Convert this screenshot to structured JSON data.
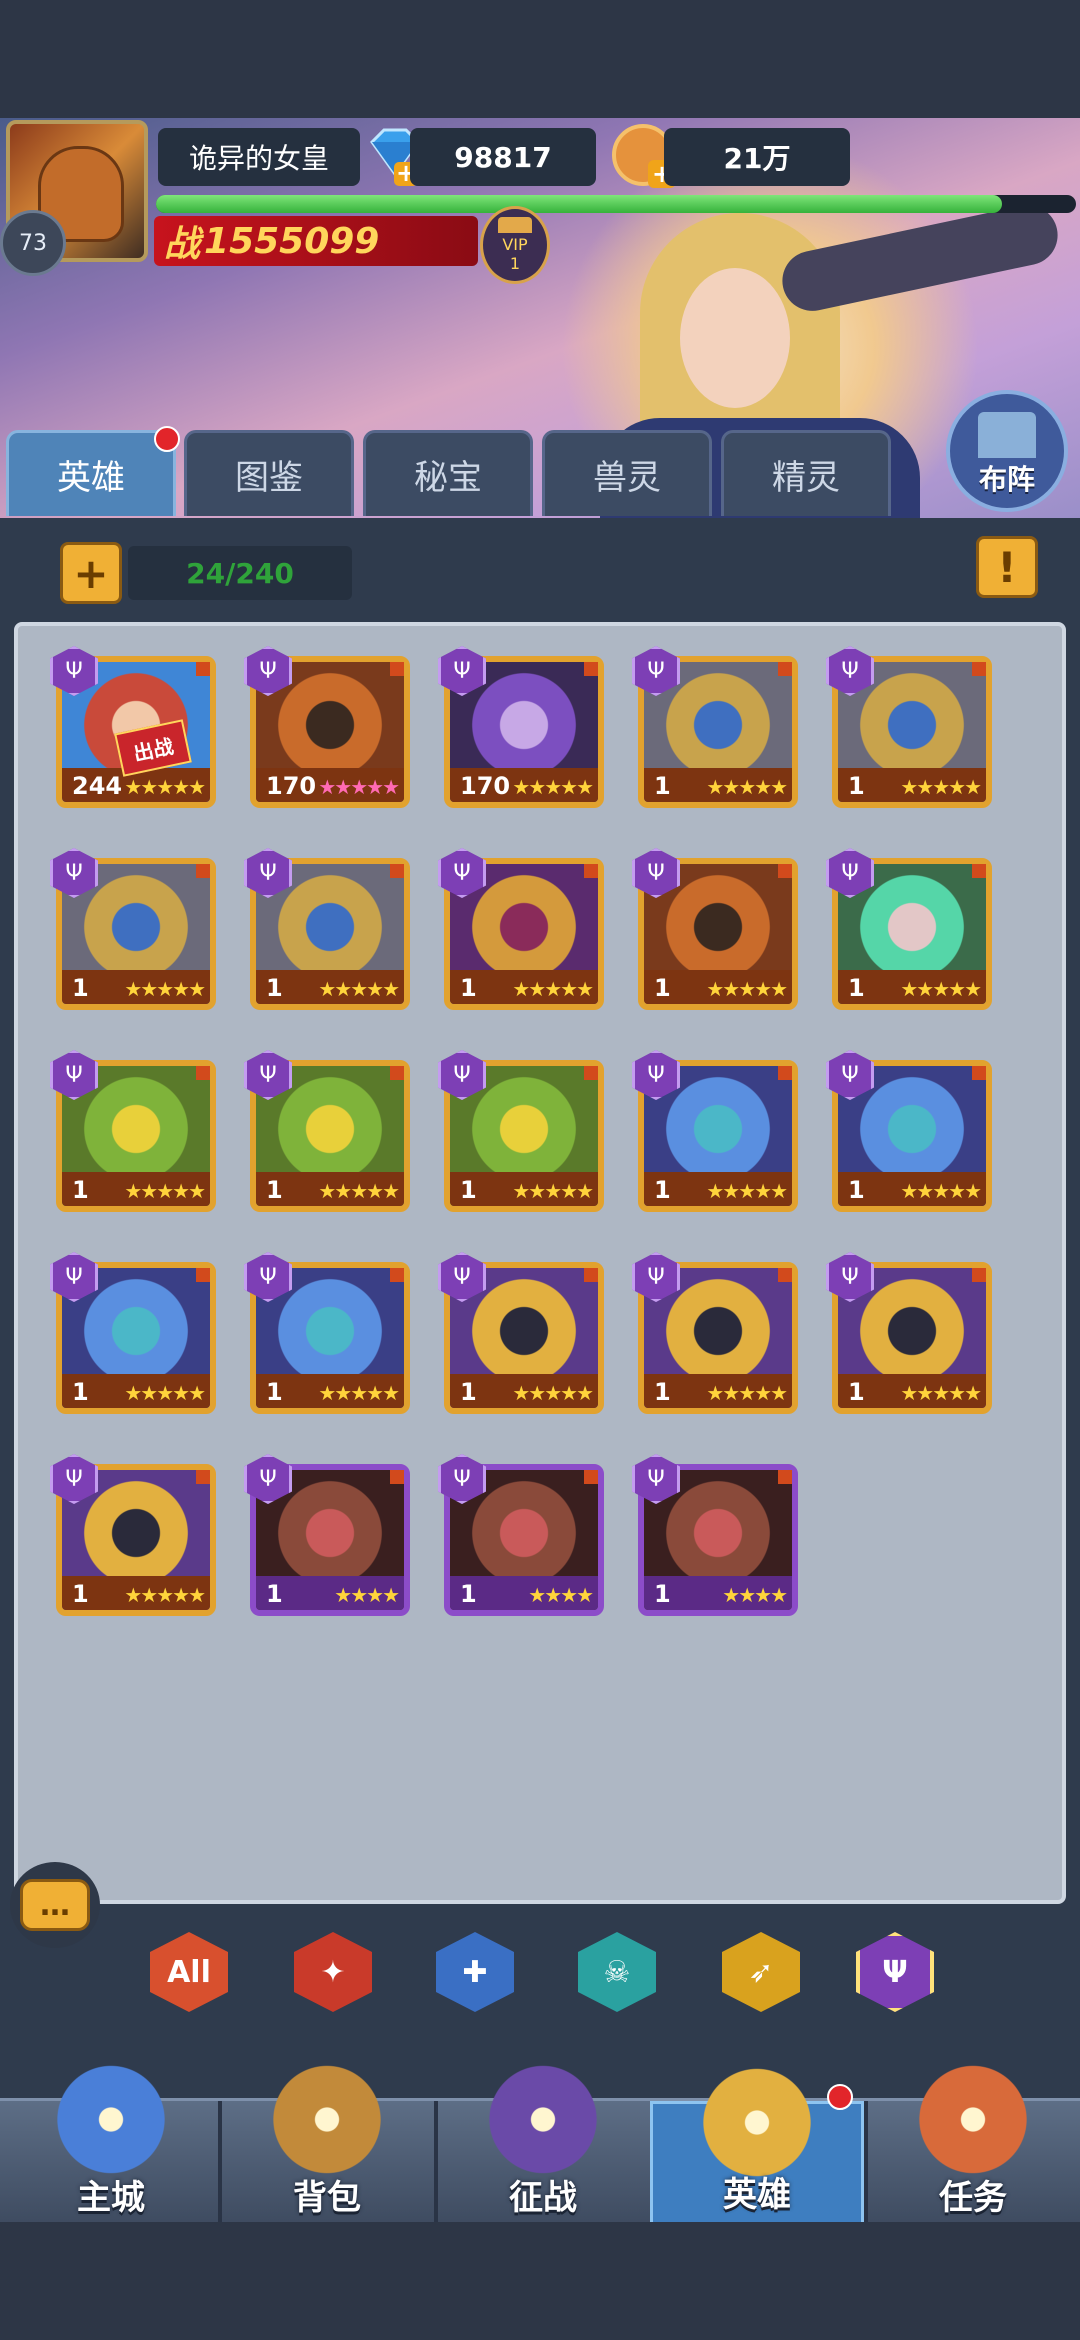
{
  "player": {
    "name": "诡异的女皇",
    "level": "73",
    "gems": "98817",
    "gold": "21万",
    "power_prefix": "战",
    "power": "1555099",
    "vip_label": "VIP",
    "vip_level": "1",
    "exp_progress": 0.92
  },
  "tabs": [
    {
      "label": "英雄",
      "active": true,
      "notify": true
    },
    {
      "label": "图鉴",
      "active": false
    },
    {
      "label": "秘宝",
      "active": false
    },
    {
      "label": "兽灵",
      "active": false
    },
    {
      "label": "精灵",
      "active": false
    }
  ],
  "formation_label": "布阵",
  "hero_count": "24/240",
  "add_icon": "plus-icon",
  "info_icon": "exclamation-icon",
  "deploy_label": "出战",
  "heroes": [
    {
      "level": "244",
      "stars": 5,
      "rarity": "gold",
      "deployed": true,
      "portrait": "blue-hair-hero"
    },
    {
      "level": "170",
      "stars": 5,
      "rarity": "gold",
      "pink": true,
      "portrait": "red-helm-warrior"
    },
    {
      "level": "170",
      "stars": 5,
      "rarity": "gold",
      "portrait": "purple-empress"
    },
    {
      "level": "1",
      "stars": 5,
      "rarity": "gold",
      "portrait": "crowned-paladin"
    },
    {
      "level": "1",
      "stars": 5,
      "rarity": "gold",
      "portrait": "crowned-paladin"
    },
    {
      "level": "1",
      "stars": 5,
      "rarity": "gold",
      "portrait": "crowned-paladin"
    },
    {
      "level": "1",
      "stars": 5,
      "rarity": "gold",
      "portrait": "crowned-paladin"
    },
    {
      "level": "1",
      "stars": 5,
      "rarity": "gold",
      "portrait": "masked-sorcerer"
    },
    {
      "level": "1",
      "stars": 5,
      "rarity": "gold",
      "portrait": "red-helm-warrior"
    },
    {
      "level": "1",
      "stars": 5,
      "rarity": "gold",
      "portrait": "green-hair-witch"
    },
    {
      "level": "1",
      "stars": 5,
      "rarity": "gold",
      "portrait": "toad-beast"
    },
    {
      "level": "1",
      "stars": 5,
      "rarity": "gold",
      "portrait": "toad-beast"
    },
    {
      "level": "1",
      "stars": 5,
      "rarity": "gold",
      "portrait": "toad-beast"
    },
    {
      "level": "1",
      "stars": 5,
      "rarity": "gold",
      "portrait": "blue-troll"
    },
    {
      "level": "1",
      "stars": 5,
      "rarity": "gold",
      "portrait": "blue-troll"
    },
    {
      "level": "1",
      "stars": 5,
      "rarity": "gold",
      "portrait": "blue-troll"
    },
    {
      "level": "1",
      "stars": 5,
      "rarity": "gold",
      "portrait": "blue-troll"
    },
    {
      "level": "1",
      "stars": 5,
      "rarity": "gold",
      "portrait": "gold-mask"
    },
    {
      "level": "1",
      "stars": 5,
      "rarity": "gold",
      "portrait": "gold-mask"
    },
    {
      "level": "1",
      "stars": 5,
      "rarity": "gold",
      "portrait": "gold-mask"
    },
    {
      "level": "1",
      "stars": 5,
      "rarity": "gold",
      "portrait": "gold-mask"
    },
    {
      "level": "1",
      "stars": 4,
      "rarity": "purple",
      "portrait": "bear-beast"
    },
    {
      "level": "1",
      "stars": 4,
      "rarity": "purple",
      "portrait": "bear-beast"
    },
    {
      "level": "1",
      "stars": 4,
      "rarity": "purple",
      "portrait": "bear-beast"
    }
  ],
  "filters": [
    {
      "label": "All",
      "icon": "all-filter-icon",
      "color": "#d8502e"
    },
    {
      "label": "",
      "icon": "fire-filter-icon",
      "color": "#c93a2a"
    },
    {
      "label": "",
      "icon": "cross-filter-icon",
      "color": "#3a6fc4"
    },
    {
      "label": "",
      "icon": "skull-filter-icon",
      "color": "#2aa1a0"
    },
    {
      "label": "",
      "icon": "wing-filter-icon",
      "color": "#d9a21e"
    },
    {
      "label": "",
      "icon": "trident-filter-icon",
      "color": "#7d3fb5"
    }
  ],
  "nav": [
    {
      "label": "主城",
      "icon": "castle-icon"
    },
    {
      "label": "背包",
      "icon": "chest-icon"
    },
    {
      "label": "征战",
      "icon": "dragon-portal-icon"
    },
    {
      "label": "英雄",
      "icon": "hero-helmet-icon",
      "active": true,
      "notify": true
    },
    {
      "label": "任务",
      "icon": "scroll-icon"
    }
  ],
  "colors": {
    "gold_frame": "#e2a22e",
    "purple_frame": "#8c4cc9",
    "active_tab": "#4f84b8",
    "count_text": "#2fa33a"
  }
}
